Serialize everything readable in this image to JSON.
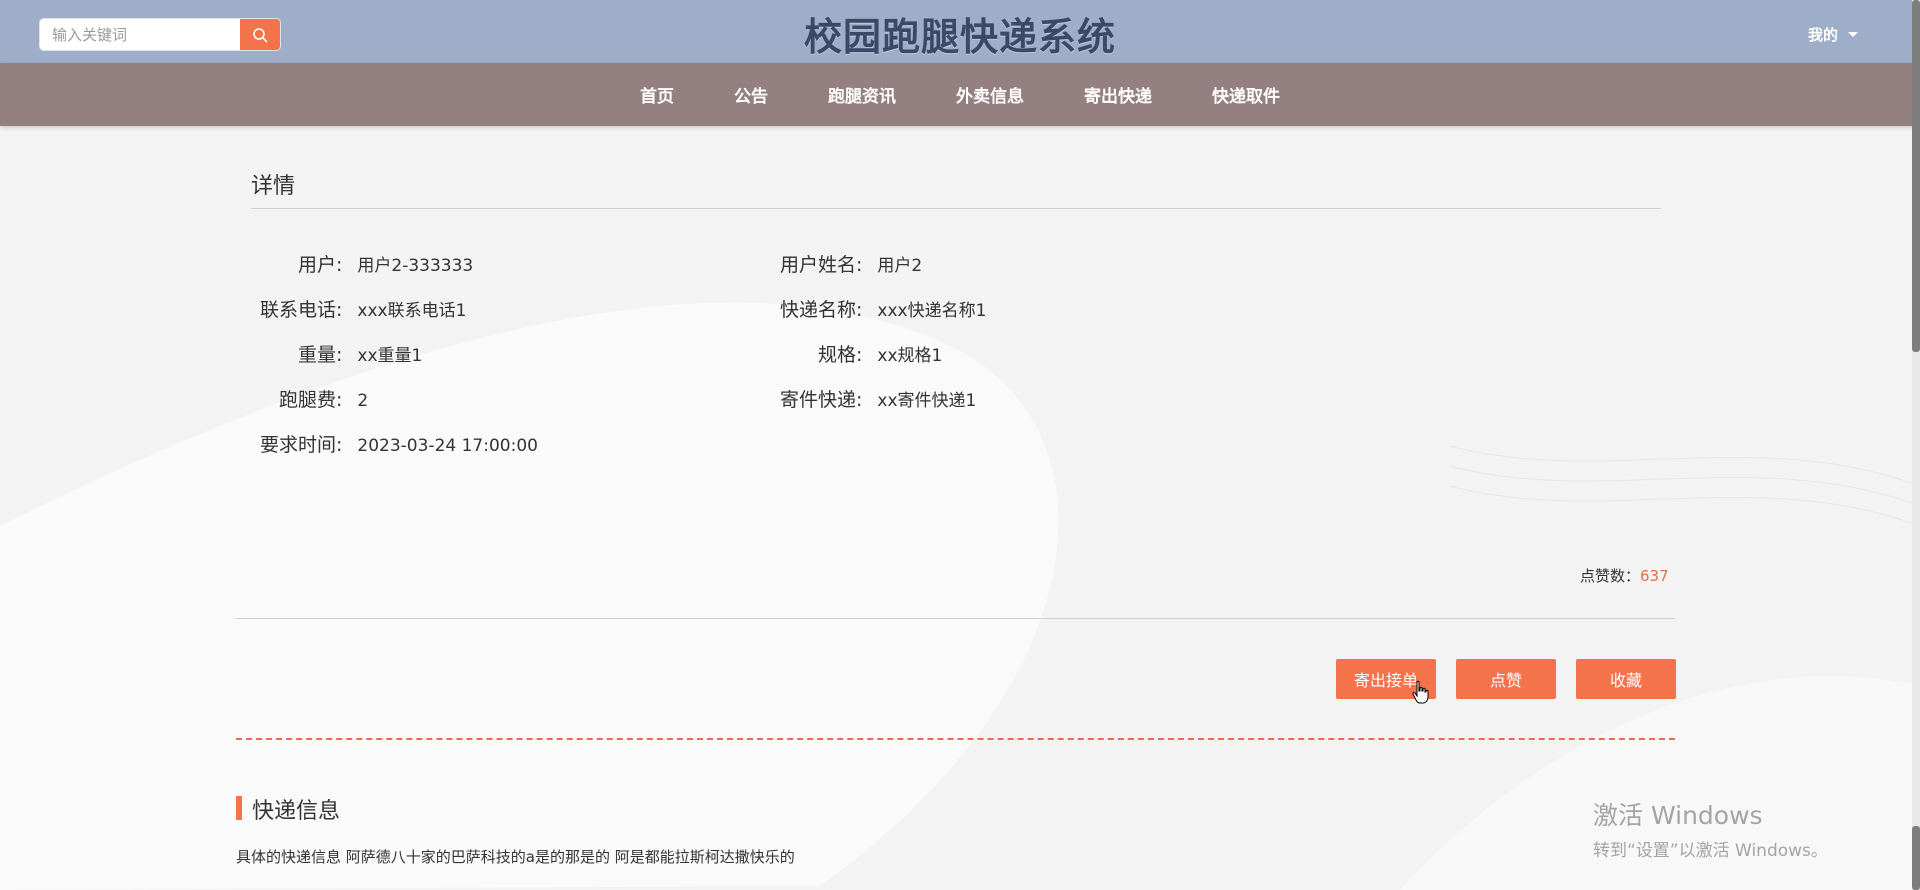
{
  "header": {
    "search_placeholder": "输入关键词",
    "site_title": "校园跑腿快递系统",
    "user_menu_label": "我的"
  },
  "nav": {
    "items": [
      "首页",
      "公告",
      "跑腿资讯",
      "外卖信息",
      "寄出快递",
      "快递取件"
    ]
  },
  "detail": {
    "section_title": "详情",
    "fields": [
      {
        "label": "用户",
        "value": "用户2-333333"
      },
      {
        "label": "用户姓名",
        "value": "用户2"
      },
      {
        "label": "联系电话",
        "value": "xxx联系电话1"
      },
      {
        "label": "快递名称",
        "value": "xxx快递名称1"
      },
      {
        "label": "重量",
        "value": "xx重量1"
      },
      {
        "label": "规格",
        "value": "xx规格1"
      },
      {
        "label": "跑腿费",
        "value": "2"
      },
      {
        "label": "寄件快递",
        "value": "xx寄件快递1"
      },
      {
        "label": "要求时间",
        "value": "2023-03-24 17:00:00"
      }
    ],
    "colon": ":",
    "likes_label": "点赞数：",
    "likes_count": "637"
  },
  "actions": {
    "order_label": "寄出接单",
    "like_label": "点赞",
    "favorite_label": "收藏"
  },
  "info": {
    "title": "快递信息",
    "content": "具体的快递信息 阿萨德八十家的巴萨科技的a是的那是的 阿是都能拉斯柯达撒快乐的"
  },
  "watermark": {
    "line1": "激活 Windows",
    "line2": "转到“设置”以激活 Windows。"
  },
  "colors": {
    "header_bg": "#9eaec9",
    "nav_bg": "#958081",
    "accent": "#f4734b",
    "title_color": "#3a4965"
  },
  "icons": {
    "search": "search-icon",
    "caret": "chevron-down-icon",
    "cursor": "hand-pointer-icon"
  }
}
